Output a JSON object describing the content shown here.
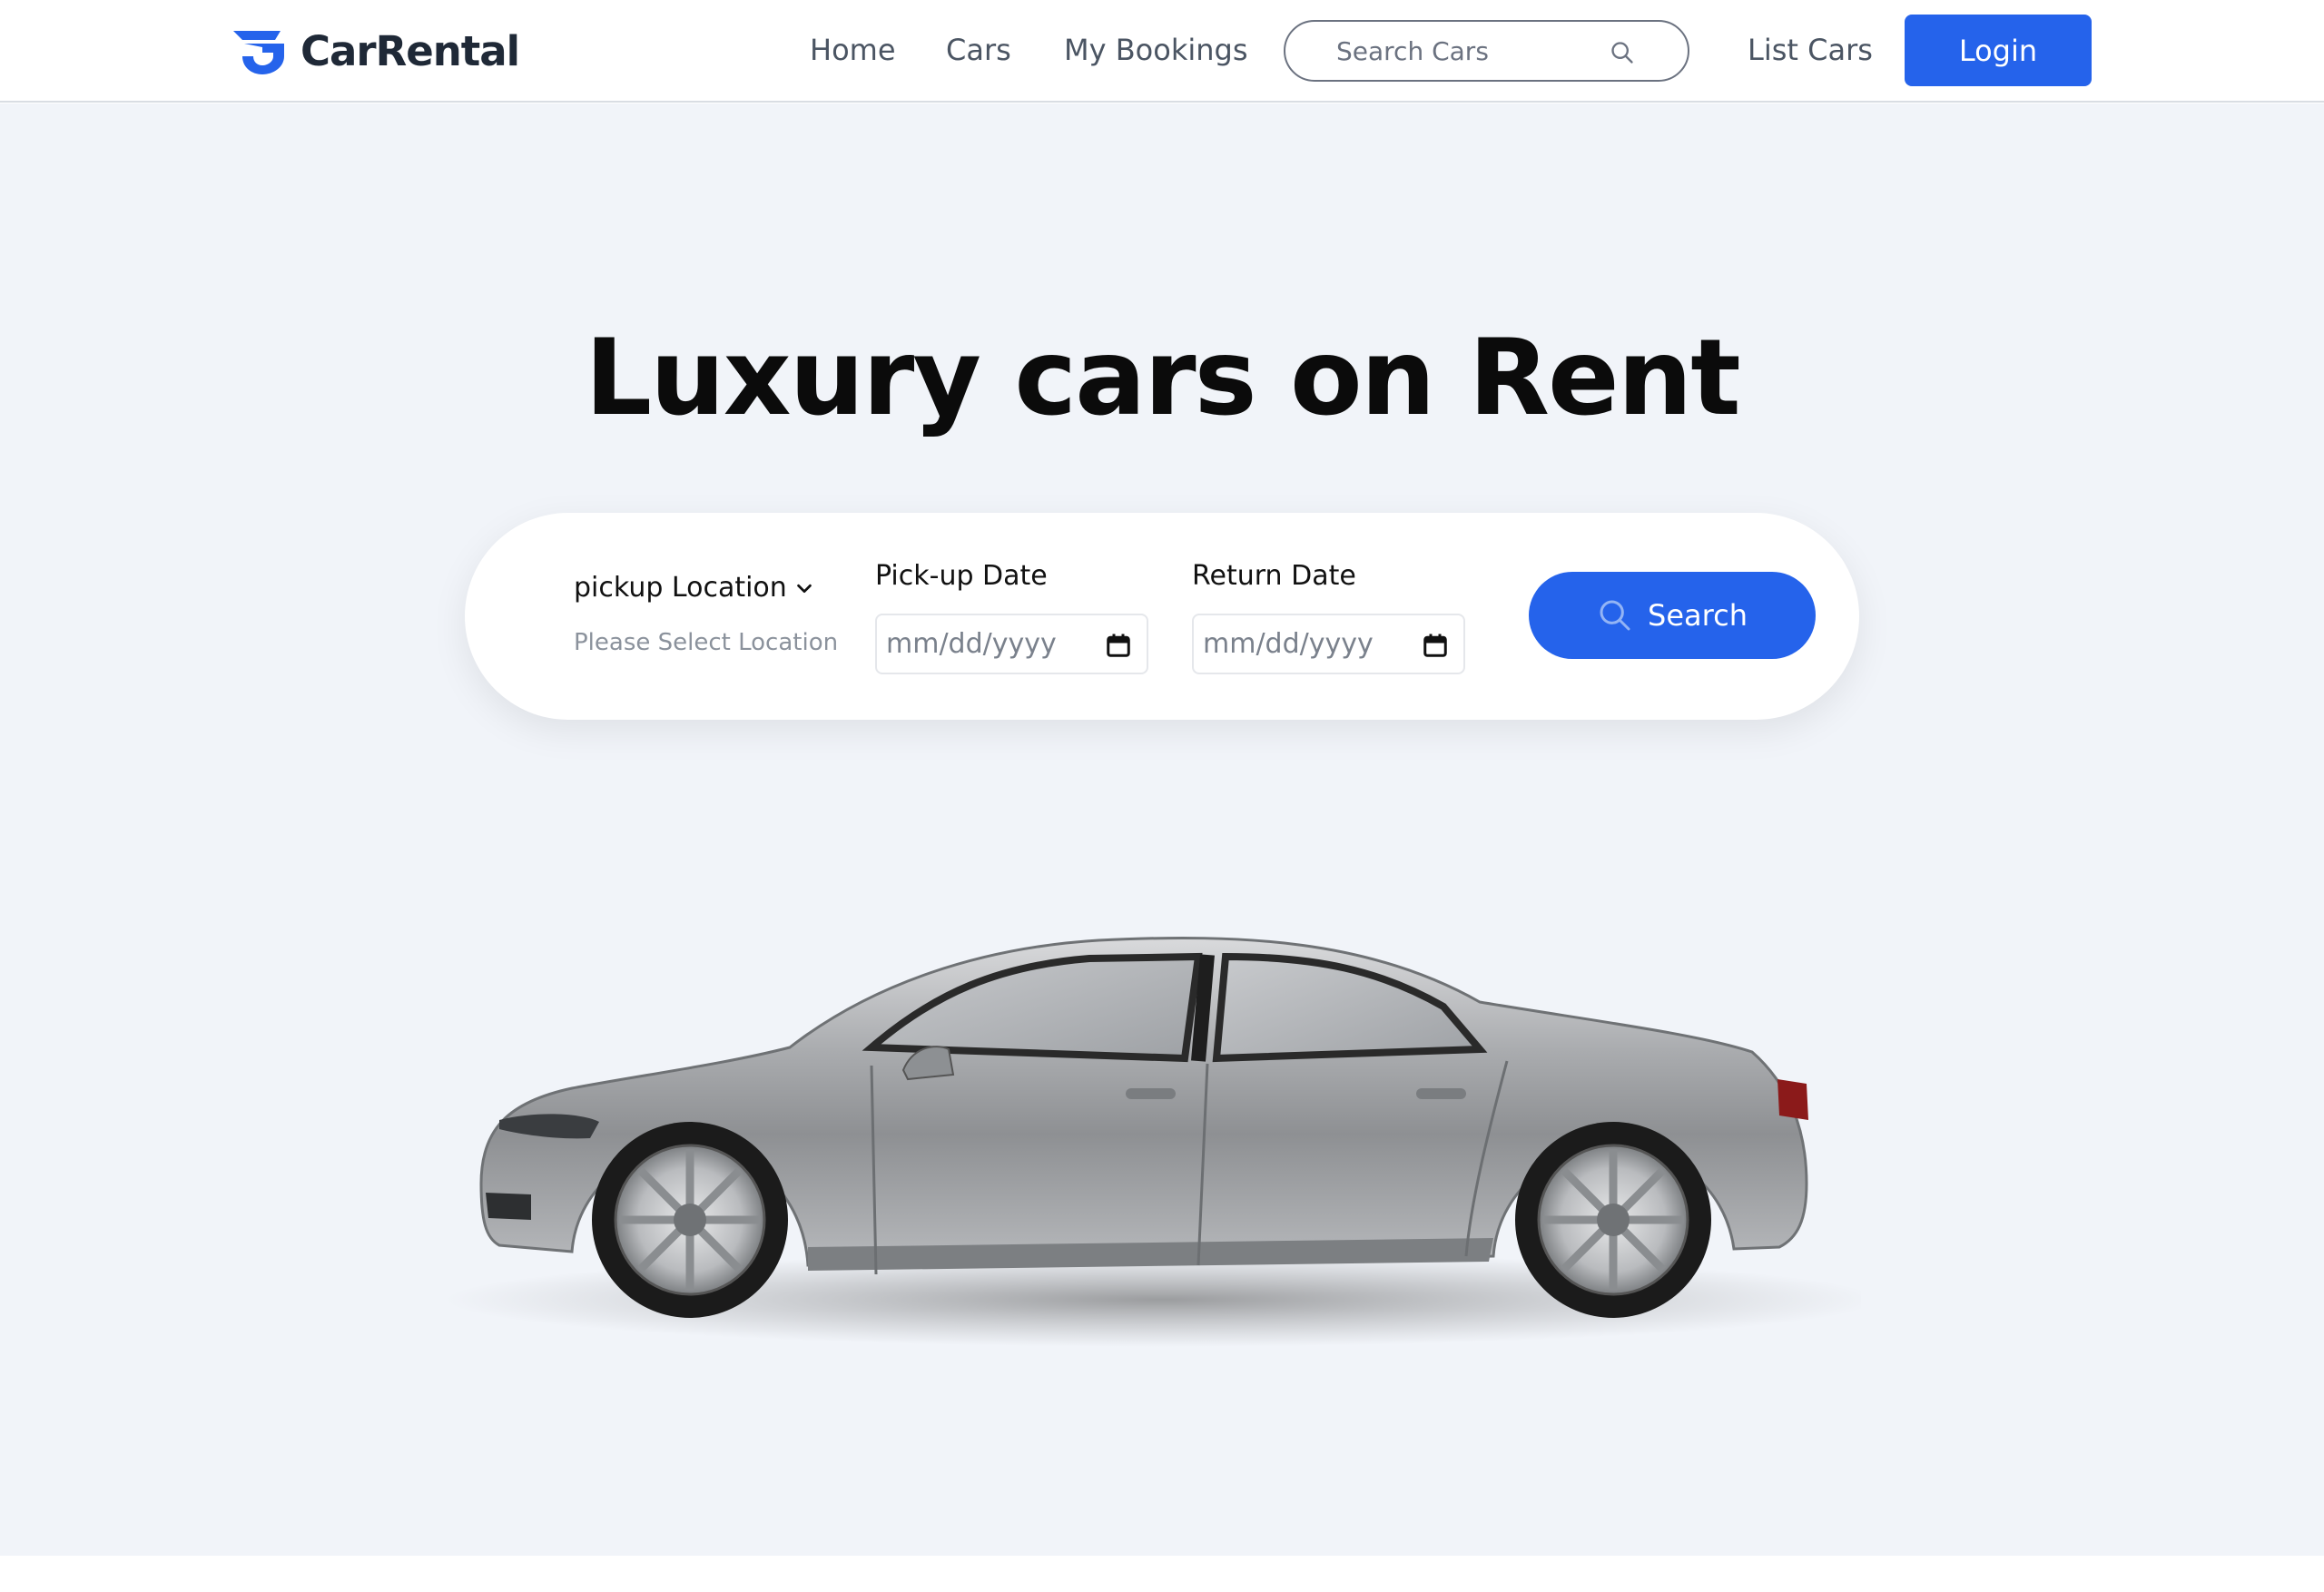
{
  "brand": {
    "name": "CarRental",
    "accent": "#2563eb"
  },
  "nav": {
    "links": [
      "Home",
      "Cars",
      "My Bookings",
      "List Cars"
    ],
    "search_placeholder": "Search Cars",
    "login_label": "Login"
  },
  "hero": {
    "title": "Luxury cars on Rent",
    "background": "#f1f4f9"
  },
  "search_form": {
    "location_label": "pickup Location",
    "location_placeholder": "Please Select Location",
    "pickup_label": "Pick-up Date",
    "return_label": "Return Date",
    "date_placeholder": "mm/dd/yyyy",
    "search_label": "Search"
  },
  "icons": [
    "logo-icon",
    "search-icon",
    "chevron-down-icon",
    "calendar-icon",
    "car-image"
  ]
}
